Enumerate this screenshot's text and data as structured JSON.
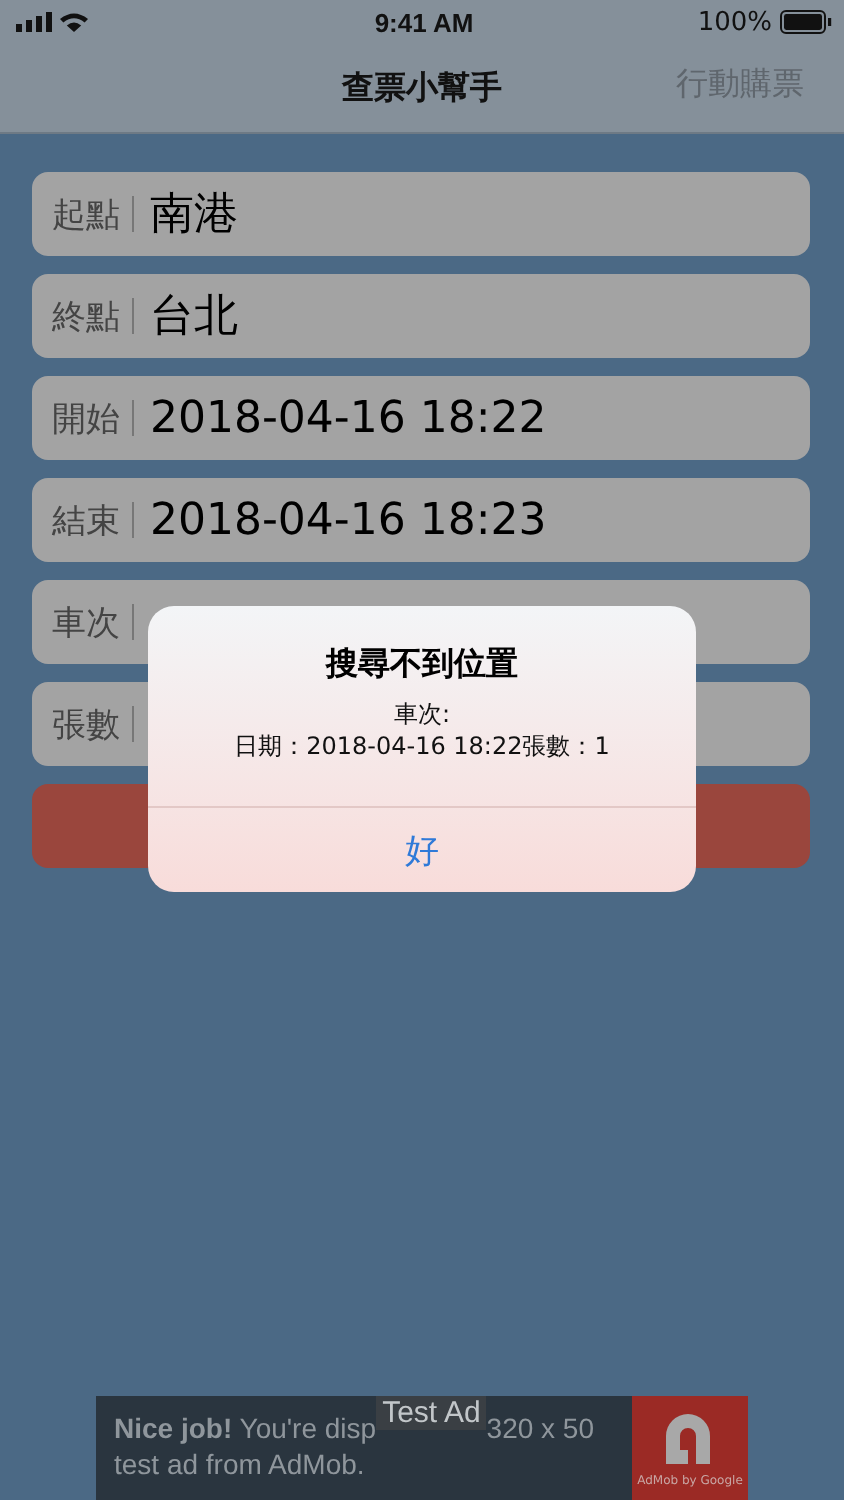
{
  "status_bar": {
    "time": "9:41 AM",
    "battery": "100%"
  },
  "nav_bar": {
    "title": "查票小幫手",
    "action": "行動購票"
  },
  "fields": [
    {
      "label": "起點",
      "value": "南港"
    },
    {
      "label": "終點",
      "value": "台北"
    },
    {
      "label": "開始",
      "value": "2018-04-16 18:22"
    },
    {
      "label": "結束",
      "value": "2018-04-16 18:23"
    },
    {
      "label": "車次"
    },
    {
      "label": "張數"
    }
  ],
  "alert": {
    "title": "搜尋不到位置",
    "message_lines": [
      "車次:",
      "日期：2018-04-16 18:22張數：1"
    ],
    "button": "好"
  },
  "ad": {
    "line_1": "**Nice job!** You're disp",
    "line_1_end": "320 x 50",
    "line_2": "test ad from AdMob.",
    "badge": "Test Ad",
    "logo_caption": "AdMob by Google"
  }
}
